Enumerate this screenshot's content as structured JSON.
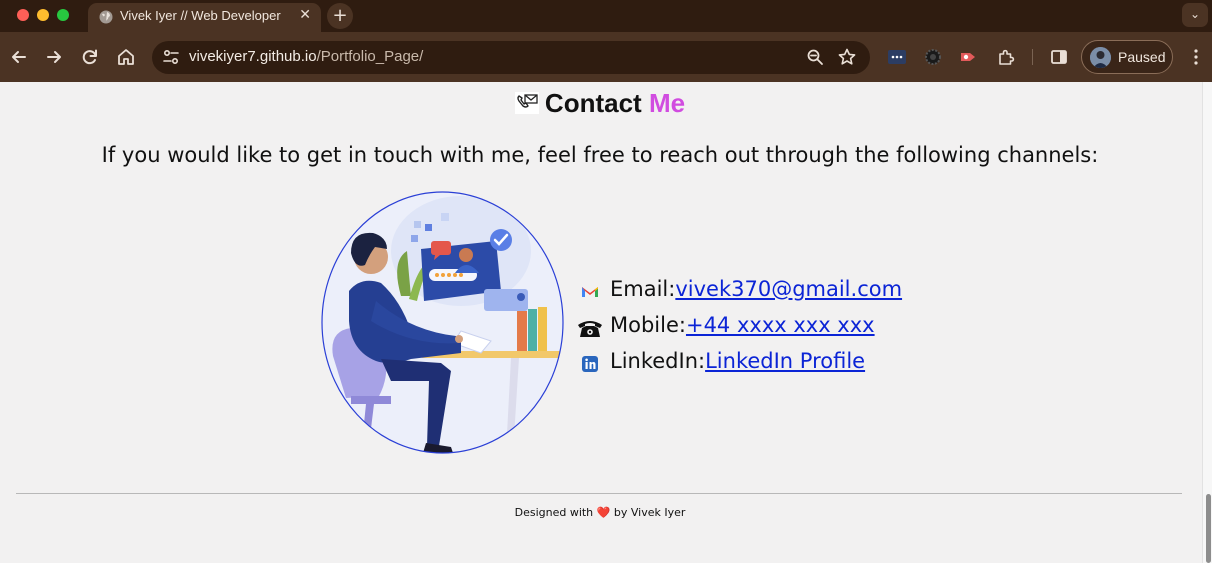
{
  "browser": {
    "tab": {
      "title": "Vivek Iyer // Web Developer",
      "close_glyph": "✕"
    },
    "new_tab_glyph": "+",
    "tab_menu_glyph": "⌄",
    "url": {
      "host": "vivekiyer7.github.io",
      "path": "/Portfolio_Page/"
    },
    "profile_label": "Paused",
    "toolbar_icons": [
      "back-icon",
      "forward-icon",
      "reload-icon",
      "home-icon",
      "site-settings-icon",
      "zoom-icon",
      "bookmark-star-icon",
      "extensions-icon",
      "side-panel-icon",
      "menu-icon"
    ],
    "accent_colors": {
      "tabbar": "#2f1c10",
      "toolbar": "#4b3323"
    }
  },
  "page": {
    "heading": {
      "word1": "Contact",
      "word2": "Me",
      "accent": "#d14ce0"
    },
    "intro": "If you would like to get in touch with me, feel free to reach out through the following channels:",
    "contacts": [
      {
        "icon": "gmail-icon",
        "label": "Email:",
        "link": "vivek370@gmail.com"
      },
      {
        "icon": "telephone-icon",
        "label": "Mobile:",
        "link": "+44 xxxx xxx xxx"
      },
      {
        "icon": "linkedin-icon",
        "label": "LinkedIn:",
        "link": "LinkedIn Profile"
      }
    ],
    "footer": {
      "prefix": "Designed with",
      "heart": "❤️",
      "suffix": "by Vivek Iyer"
    },
    "link_color": "#0b24d6"
  }
}
